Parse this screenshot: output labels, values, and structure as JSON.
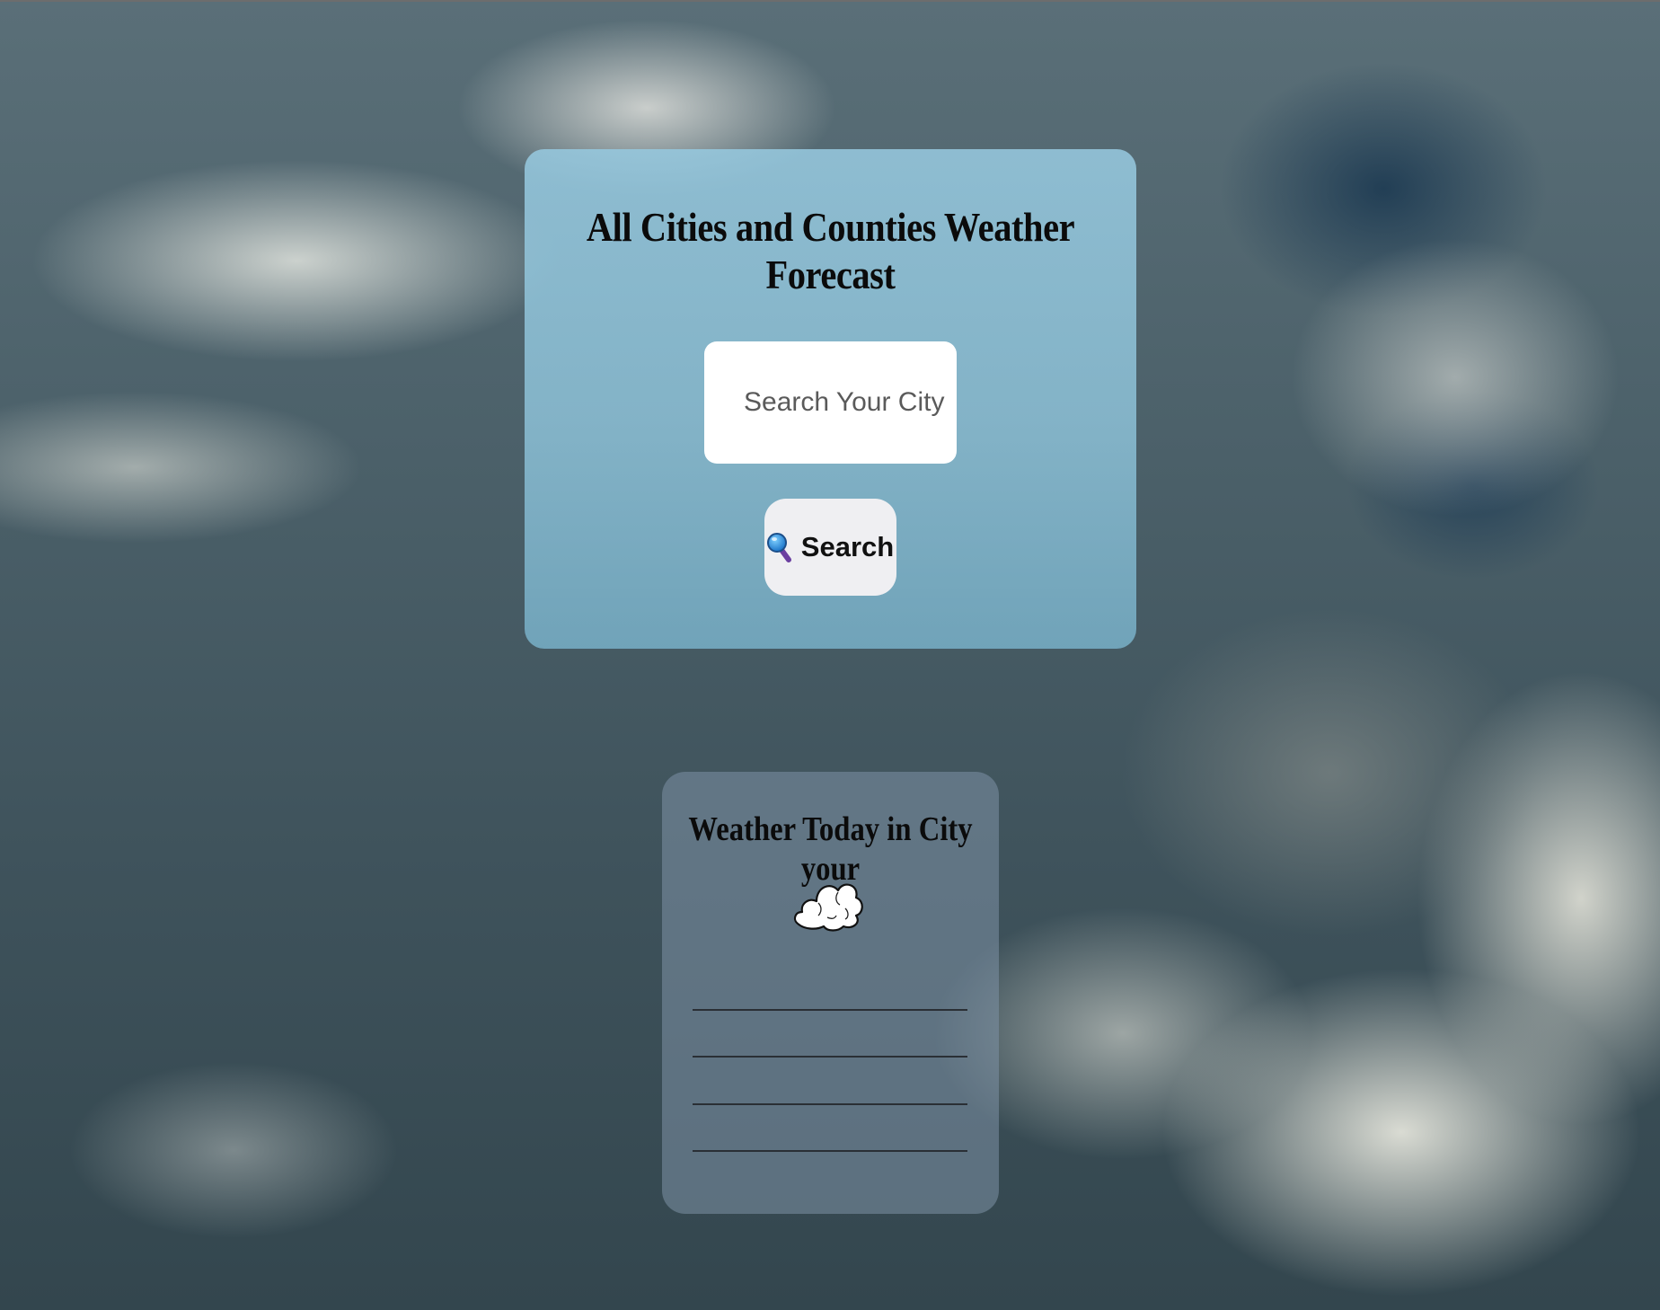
{
  "header": {
    "title": "All Cities and Counties Weather Forecast"
  },
  "search": {
    "placeholder": "Search Your City",
    "button_label": "Search",
    "button_icon": "magnifying-glass-icon"
  },
  "weather": {
    "title": "Weather Today in City your",
    "icon": "cloud-icon",
    "rows": [
      "",
      "",
      "",
      ""
    ]
  }
}
